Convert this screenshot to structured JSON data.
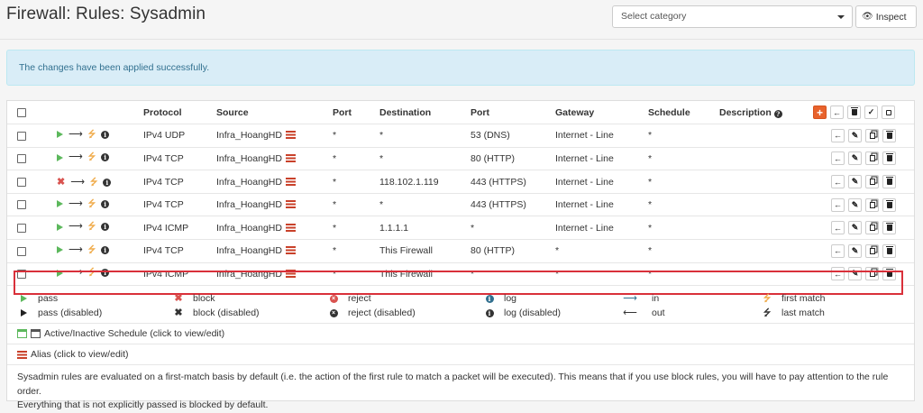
{
  "header": {
    "title": "Firewall: Rules: Sysadmin",
    "category_placeholder": "Select category",
    "inspect_label": "Inspect"
  },
  "alert": {
    "message": "The changes have been applied successfully."
  },
  "table": {
    "columns": [
      "Protocol",
      "Source",
      "Port",
      "Destination",
      "Port",
      "Gateway",
      "Schedule",
      "Description"
    ],
    "rows": [
      {
        "action": "pass",
        "protocol": "IPv4 UDP",
        "source": "Infra_HoangHD",
        "src_port": "*",
        "destination": "*",
        "dst_port": "53 (DNS)",
        "gateway": "Internet - Line",
        "schedule": "*",
        "description": ""
      },
      {
        "action": "pass",
        "protocol": "IPv4 TCP",
        "source": "Infra_HoangHD",
        "src_port": "*",
        "destination": "*",
        "dst_port": "80 (HTTP)",
        "gateway": "Internet - Line",
        "schedule": "*",
        "description": ""
      },
      {
        "action": "block",
        "protocol": "IPv4 TCP",
        "source": "Infra_HoangHD",
        "src_port": "*",
        "destination": "118.102.1.119",
        "dst_port": "443 (HTTPS)",
        "gateway": "Internet - Line",
        "schedule": "*",
        "description": ""
      },
      {
        "action": "pass",
        "protocol": "IPv4 TCP",
        "source": "Infra_HoangHD",
        "src_port": "*",
        "destination": "*",
        "dst_port": "443 (HTTPS)",
        "gateway": "Internet - Line",
        "schedule": "*",
        "description": ""
      },
      {
        "action": "pass",
        "protocol": "IPv4 ICMP",
        "source": "Infra_HoangHD",
        "src_port": "*",
        "destination": "1.1.1.1",
        "dst_port": "*",
        "gateway": "Internet - Line",
        "schedule": "*",
        "description": ""
      },
      {
        "action": "pass",
        "protocol": "IPv4 TCP",
        "source": "Infra_HoangHD",
        "src_port": "*",
        "destination": "This Firewall",
        "dst_port": "80 (HTTP)",
        "gateway": "*",
        "schedule": "*",
        "description": ""
      },
      {
        "action": "pass",
        "protocol": "IPv4 ICMP",
        "source": "Infra_HoangHD",
        "src_port": "*",
        "destination": "This Firewall",
        "dst_port": "*",
        "gateway": "*",
        "schedule": "*",
        "description": ""
      }
    ]
  },
  "legend": {
    "pass": "pass",
    "pass_disabled": "pass (disabled)",
    "block": "block",
    "block_disabled": "block (disabled)",
    "reject": "reject",
    "reject_disabled": "reject (disabled)",
    "log": "log",
    "log_disabled": "log (disabled)",
    "in": "in",
    "out": "out",
    "first_match": "first match",
    "last_match": "last match"
  },
  "schedule_note": "Active/Inactive Schedule (click to view/edit)",
  "alias_note": "Alias (click to view/edit)",
  "notice_line1": "Sysadmin rules are evaluated on a first-match basis by default (i.e. the action of the first rule to match a packet will be executed). This means that if you use block rules, you will have to pay attention to the rule order.",
  "notice_line2": "Everything that is not explicitly passed is blocked by default.",
  "colors": {
    "accent": "#e8622c",
    "pass": "#5cb85c",
    "block": "#d9534f",
    "alert_bg": "#d9edf7",
    "highlight": "#d9303a"
  }
}
